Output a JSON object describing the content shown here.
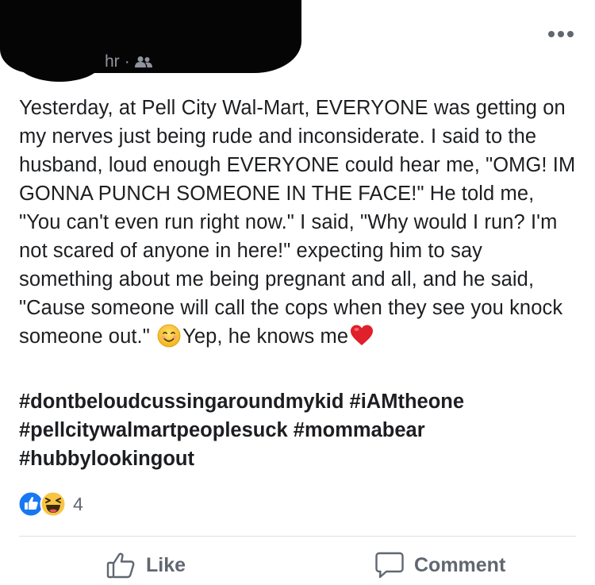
{
  "post": {
    "meta_time": "hr",
    "text_main": "Yesterday, at Pell City Wal-Mart, EVERYONE was getting on my nerves just being rude and inconsiderate. I said to the husband, loud enough EVERYONE could hear me, \"OMG! IM GONNA PUNCH SOMEONE IN THE FACE!\" He told me, \"You can't even run right now.\" I said, \"Why would I run? I'm not scared of anyone in here!\" expecting him to say something about me being pregnant and all, and he said, \"Cause someone will call the cops when they see you knock someone out.\"",
    "text_after_emoji": "Yep, he knows me",
    "hashtags": "#dontbeloudcussingaroundmykid #iAMtheone #pellcitywalmartpeoplesuck #mommabear #hubbylookingout"
  },
  "reactions": {
    "count": "4",
    "types": [
      "like-icon",
      "haha-icon"
    ]
  },
  "actions": {
    "like_label": "Like",
    "comment_label": "Comment"
  },
  "colors": {
    "like_blue": "#1877f2",
    "haha_yellow": "#f7c544",
    "text_dark": "#1c1e21",
    "text_gray": "#606770",
    "redaction": "#050505"
  }
}
